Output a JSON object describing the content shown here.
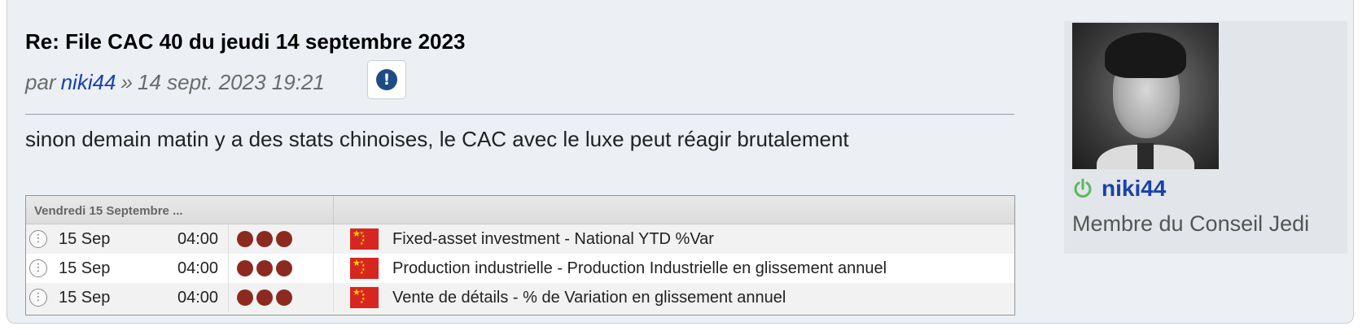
{
  "post": {
    "title": "Re: File CAC 40 du jeudi 14 septembre 2023",
    "byline_prefix": "par",
    "author": "niki44",
    "separator": "»",
    "timestamp": "14 sept. 2023 19:21",
    "report_icon": "exclamation-circle-icon",
    "content": "sinon demain matin y a des stats chinoises, le CAC avec le luxe peut réagir brutalement"
  },
  "calendar": {
    "header_date": "Vendredi 15 Septembre ...",
    "rows": [
      {
        "date": "15 Sep",
        "time": "04:00",
        "importance": 3,
        "country_flag": "china-flag-icon",
        "event": "Fixed-asset investment - National YTD %Var"
      },
      {
        "date": "15 Sep",
        "time": "04:00",
        "importance": 3,
        "country_flag": "china-flag-icon",
        "event": "Production industrielle - Production Industrielle en glissement annuel"
      },
      {
        "date": "15 Sep",
        "time": "04:00",
        "importance": 3,
        "country_flag": "china-flag-icon",
        "event": "Vente de détails - % de Variation en glissement annuel"
      }
    ]
  },
  "profile": {
    "username": "niki44",
    "status_icon": "online-power-icon",
    "rank": "Membre du Conseil Jedi"
  },
  "colors": {
    "link": "#1a42a8",
    "online": "#5cb85c",
    "importance_dot": "#8c2a1f",
    "flag_red": "#d7261f"
  }
}
